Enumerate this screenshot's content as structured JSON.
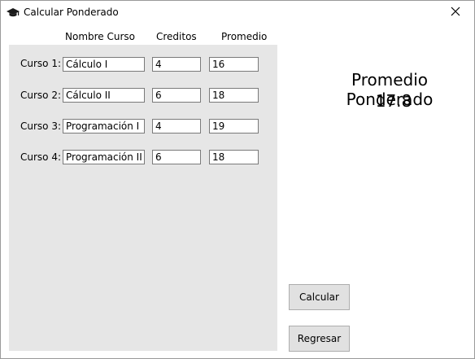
{
  "window": {
    "title": "Calcular Ponderado"
  },
  "table": {
    "headers": {
      "name": "Nombre Curso",
      "credits": "Creditos",
      "average": "Promedio"
    },
    "rows": [
      {
        "label": "Curso 1:",
        "name": "Cálculo I",
        "credits": "4",
        "average": "16"
      },
      {
        "label": "Curso 2:",
        "name": "Cálculo II",
        "credits": "6",
        "average": "18"
      },
      {
        "label": "Curso 3:",
        "name": "Programación I",
        "credits": "4",
        "average": "19"
      },
      {
        "label": "Curso 4:",
        "name": "Programación II",
        "credits": "6",
        "average": "18"
      }
    ]
  },
  "result": {
    "label": "Promedio Ponderado",
    "value": "17.8"
  },
  "buttons": {
    "calculate": "Calcular",
    "back": "Regresar"
  },
  "icons": {
    "app": "graduation-cap-icon",
    "close": "close-icon"
  }
}
